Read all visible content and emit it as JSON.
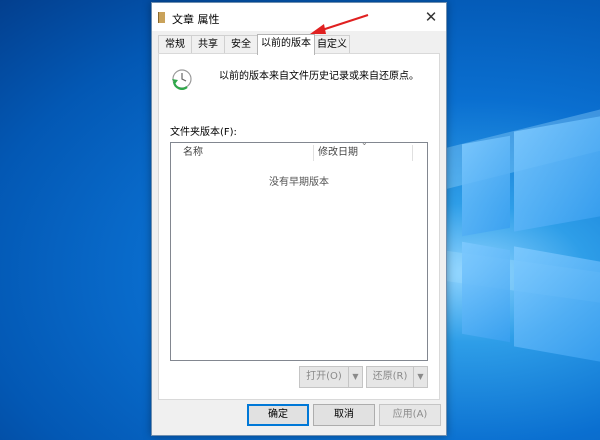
{
  "dialog": {
    "title": "文章 属性",
    "close_glyph": "✕",
    "tabs": [
      "常规",
      "共享",
      "安全",
      "以前的版本",
      "自定义"
    ],
    "active_tab": "以前的版本",
    "description": "以前的版本来自文件历史记录或来自还原点。",
    "folder_versions_label": "文件夹版本(F):",
    "columns": [
      "名称",
      "修改日期"
    ],
    "empty_text": "没有早期版本",
    "open_button": "打开(O)",
    "restore_button": "还原(R)",
    "dropdown_glyph": "▼",
    "ok_button": "确定",
    "cancel_button": "取消",
    "apply_button": "应用(A)"
  },
  "colors": {
    "annotation_arrow": "#e02020",
    "accent": "#0078d7"
  },
  "icons": [
    "folder-icon",
    "close-icon",
    "restore-history-icon",
    "dropdown-arrow-icon"
  ]
}
